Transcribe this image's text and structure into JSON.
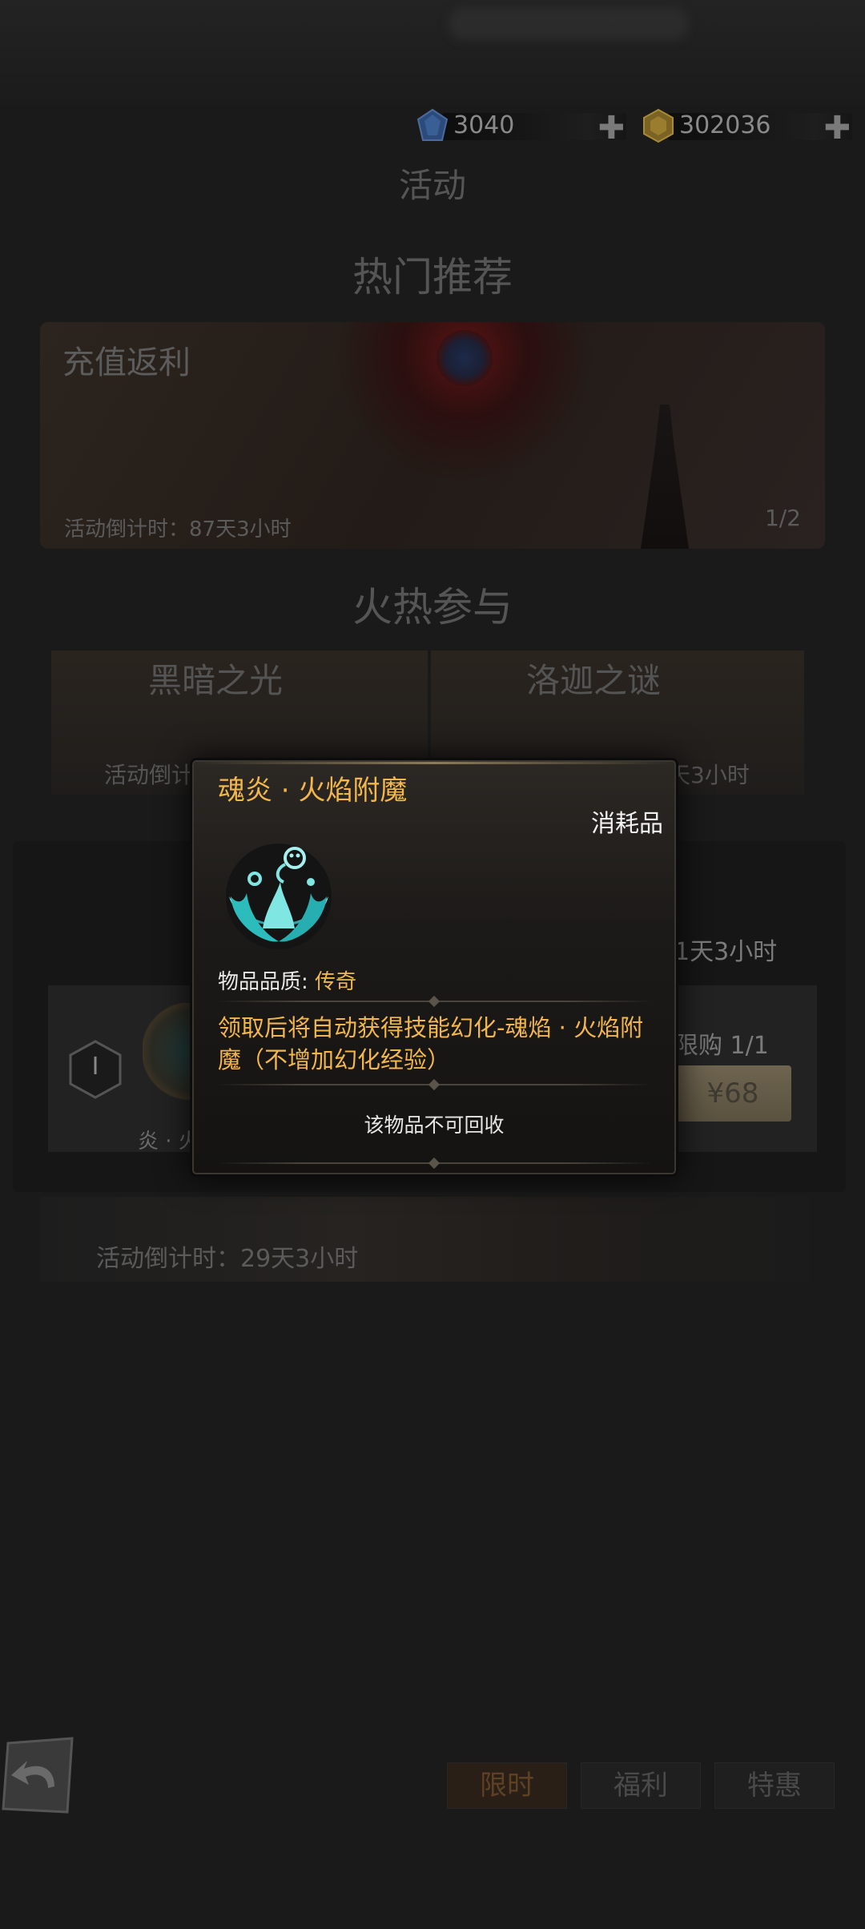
{
  "currency": {
    "gems": "3040",
    "gold": "302036"
  },
  "header": {
    "title": "活动",
    "hot_section": "热门推荐",
    "fire_section": "火热参与"
  },
  "banner": {
    "label": "充值返利",
    "countdown": "活动倒计时：87天3小时",
    "pager": "1/2"
  },
  "events": [
    {
      "label": "黑暗之光",
      "countdown": "活动倒计"
    },
    {
      "label": "洛迦之谜",
      "countdown": "天3小时"
    }
  ],
  "background_panel": {
    "right_countdown": "1天3小时",
    "limit": "限购 1/1",
    "price": "¥68",
    "hex_roman": "I",
    "partial_label": "炎 · 火"
  },
  "lower_card": {
    "countdown": "活动倒计时：29天3小时"
  },
  "tabs": [
    "限时",
    "福利",
    "特惠"
  ],
  "modal": {
    "item_name": "魂炎 · 火焰附魔",
    "item_type": "消耗品",
    "quality_label": "物品品质:",
    "quality_value": "传奇",
    "description": "领取后将自动获得技能幻化-魂焰 · 火焰附魔（不增加幻化经验）",
    "footer_note": "该物品不可回收"
  },
  "colors": {
    "accent_gold": "#f2b64a",
    "icon_teal": "#39c9c9"
  }
}
